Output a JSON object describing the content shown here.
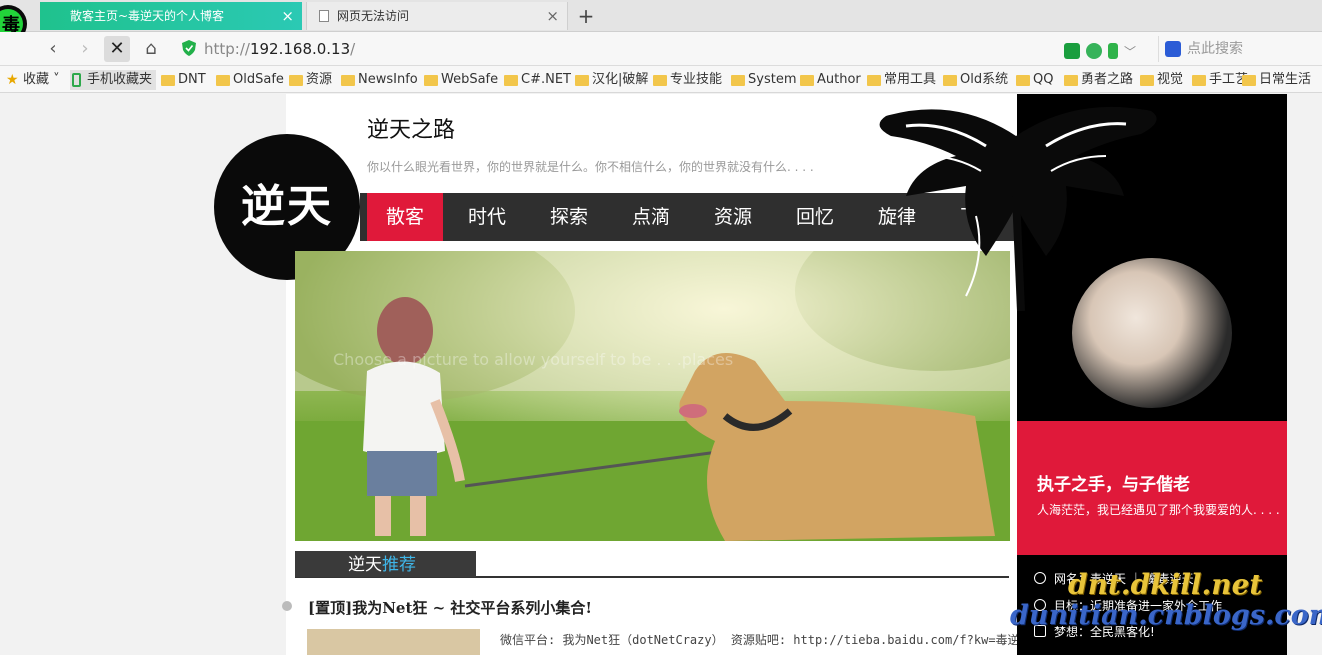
{
  "browser": {
    "tabs": [
      {
        "label": "散客主页~毒逆天的个人博客",
        "active": true
      },
      {
        "label": "网页无法访问",
        "active": false
      }
    ],
    "new_tab": "+",
    "close_glyph": "×",
    "url_prefix": "http://",
    "url_host": "192.168.0.13",
    "url_suffix": "/",
    "search_placeholder": "点此搜索",
    "bookmarks": [
      "收藏",
      "手机收藏夹",
      "DNT",
      "OldSafe",
      "资源",
      "NewsInfo",
      "WebSafe",
      "C#.NET",
      "汉化|破解",
      "专业技能",
      "System",
      "Author",
      "常用工具",
      "Old系统",
      "QQ",
      "勇者之路",
      "视觉",
      "手工艺",
      "日常生活"
    ]
  },
  "site": {
    "title": "逆天之路",
    "motto": "你以什么眼光看世界，你的世界就是什么。你不相信什么，你的世界就没有什么. . . .",
    "logo_text": "逆天",
    "nav": [
      "散客",
      "时代",
      "探索",
      "点滴",
      "资源",
      "回忆",
      "旋律",
      "飞扬"
    ],
    "banner_overlay": "Choose a picture to allow yourself to be . . .places",
    "section_title_a": "逆天",
    "section_title_b": "推荐",
    "post": {
      "title": "[置顶]我为Net狂 ~ 社交平台系列小集合!",
      "excerpt": "微信平台:  我为Net狂（dotNetCrazy） 资源贴吧: http://tieba.baidu.com/f?kw=毒逆天"
    }
  },
  "sidebar": {
    "quote_title": "执子之手，与子偕老",
    "quote_sub": "人海茫茫，我已经遇见了那个我要爱的人. . . .",
    "info": [
      {
        "icon": "info-icon",
        "label": "网名：毒逆天 ｜ 魔毒逆天"
      },
      {
        "icon": "person-icon",
        "label": "目标：近期准备进一家外企工作"
      },
      {
        "icon": "home-icon",
        "label": "梦想：全民黑客化!"
      }
    ]
  },
  "watermark": {
    "line1": "dnt.dkill.net",
    "line2": "dunitian.cnblogs.com"
  },
  "colors": {
    "accent_red": "#e0193a",
    "tab_green": "#1fc28d",
    "nav_dark": "#2f2f2f",
    "link_blue": "#3fb6e8"
  }
}
